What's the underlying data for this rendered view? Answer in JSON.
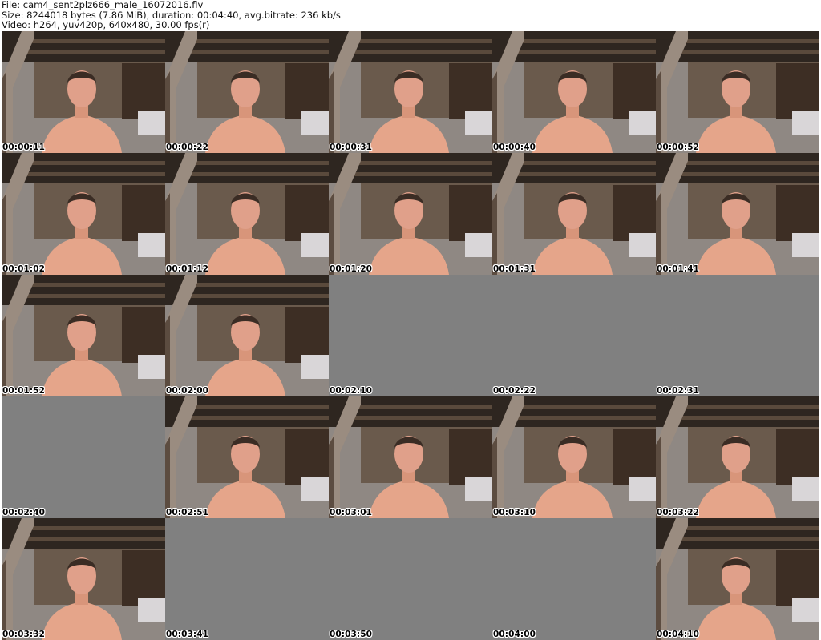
{
  "header": {
    "file_line": "File: cam4_sent2plz666_male_16072016.flv",
    "size_line": "Size: 8244018 bytes (7.86 MiB), duration: 00:04:40, avg.bitrate: 236 kb/s",
    "video_line": "Video: h264, yuv420p, 640x480, 30.00 fps(r)"
  },
  "colors": {
    "blank_frame": "#808080",
    "timestamp_text": "#000000",
    "timestamp_outline": "#ffffff"
  },
  "frames": [
    {
      "timestamp": "00:00:11",
      "blank": false
    },
    {
      "timestamp": "00:00:22",
      "blank": false
    },
    {
      "timestamp": "00:00:31",
      "blank": false
    },
    {
      "timestamp": "00:00:40",
      "blank": false
    },
    {
      "timestamp": "00:00:52",
      "blank": false
    },
    {
      "timestamp": "00:01:02",
      "blank": false
    },
    {
      "timestamp": "00:01:12",
      "blank": false
    },
    {
      "timestamp": "00:01:20",
      "blank": false
    },
    {
      "timestamp": "00:01:31",
      "blank": false
    },
    {
      "timestamp": "00:01:41",
      "blank": false
    },
    {
      "timestamp": "00:01:52",
      "blank": false
    },
    {
      "timestamp": "00:02:00",
      "blank": false
    },
    {
      "timestamp": "00:02:10",
      "blank": true
    },
    {
      "timestamp": "00:02:22",
      "blank": true
    },
    {
      "timestamp": "00:02:31",
      "blank": true
    },
    {
      "timestamp": "00:02:40",
      "blank": true
    },
    {
      "timestamp": "00:02:51",
      "blank": false
    },
    {
      "timestamp": "00:03:01",
      "blank": false
    },
    {
      "timestamp": "00:03:10",
      "blank": false
    },
    {
      "timestamp": "00:03:22",
      "blank": false
    },
    {
      "timestamp": "00:03:32",
      "blank": false
    },
    {
      "timestamp": "00:03:41",
      "blank": true
    },
    {
      "timestamp": "00:03:50",
      "blank": true
    },
    {
      "timestamp": "00:04:00",
      "blank": true
    },
    {
      "timestamp": "00:04:10",
      "blank": false
    }
  ]
}
